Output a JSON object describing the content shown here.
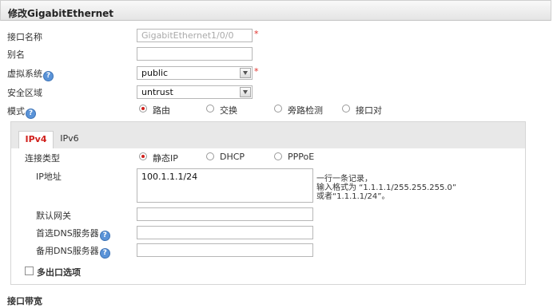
{
  "header": {
    "title": "修改GigabitEthernet"
  },
  "form": {
    "interface_name_label": "接口名称",
    "interface_name_value": "GigabitEthernet1/0/0",
    "alias_label": "别名",
    "alias_value": "",
    "vsys_label": "虚拟系统",
    "vsys_value": "public",
    "zone_label": "安全区域",
    "zone_value": "untrust",
    "mode_label": "模式",
    "mode_options": [
      "路由",
      "交换",
      "旁路检测",
      "接口对"
    ],
    "mode_selected": "路由",
    "required_mark": "*"
  },
  "tabs": {
    "ipv4": "IPv4",
    "ipv6": "IPv6",
    "active": "IPv4"
  },
  "ipv4": {
    "conn_type_label": "连接类型",
    "conn_options": [
      "静态IP",
      "DHCP",
      "PPPoE"
    ],
    "conn_selected": "静态IP",
    "ip_label": "IP地址",
    "ip_value": "100.1.1.1/24",
    "hint_lines": [
      "一行一条记录，",
      "输入格式为 “1.1.1.1/255.255.255.0”",
      "或者“1.1.1.1/24”。"
    ],
    "gateway_label": "默认网关",
    "gateway_value": "",
    "dns1_label": "首选DNS服务器",
    "dns1_value": "",
    "dns2_label": "备用DNS服务器",
    "dns2_value": "",
    "multi_exit_label": "多出口选项",
    "multi_exit_checked": false
  },
  "footer": {
    "bandwidth_label": "接口带宽"
  },
  "icons": {
    "help": "?",
    "help_icon_name": "help-icon"
  },
  "colors": {
    "accent_red": "#d0201c",
    "help_blue": "#5a93d8"
  }
}
